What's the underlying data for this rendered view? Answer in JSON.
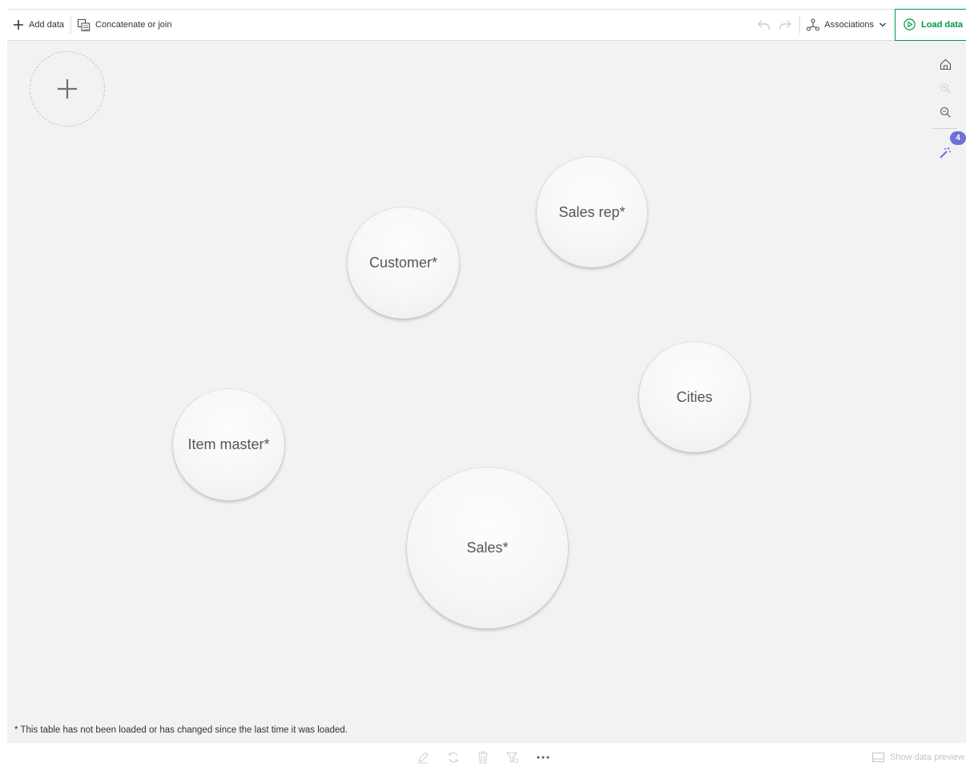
{
  "toolbar": {
    "add_data_label": "Add data",
    "concat_label": "Concatenate or join",
    "associations_label": "Associations",
    "load_data_label": "Load data"
  },
  "zoom_tools": {
    "badge_count": "4"
  },
  "tables": [
    {
      "name": "Customer*"
    },
    {
      "name": "Sales rep*"
    },
    {
      "name": "Cities"
    },
    {
      "name": "Item master*"
    },
    {
      "name": "Sales*"
    }
  ],
  "footnote": "* This table has not been loaded or has changed since the last time it was loaded.",
  "bottom_bar": {
    "show_preview_label": "Show data preview"
  },
  "colors": {
    "accent_green": "#009845",
    "badge_purple": "#6f6fd8",
    "canvas_bg": "#f2f2f2"
  }
}
